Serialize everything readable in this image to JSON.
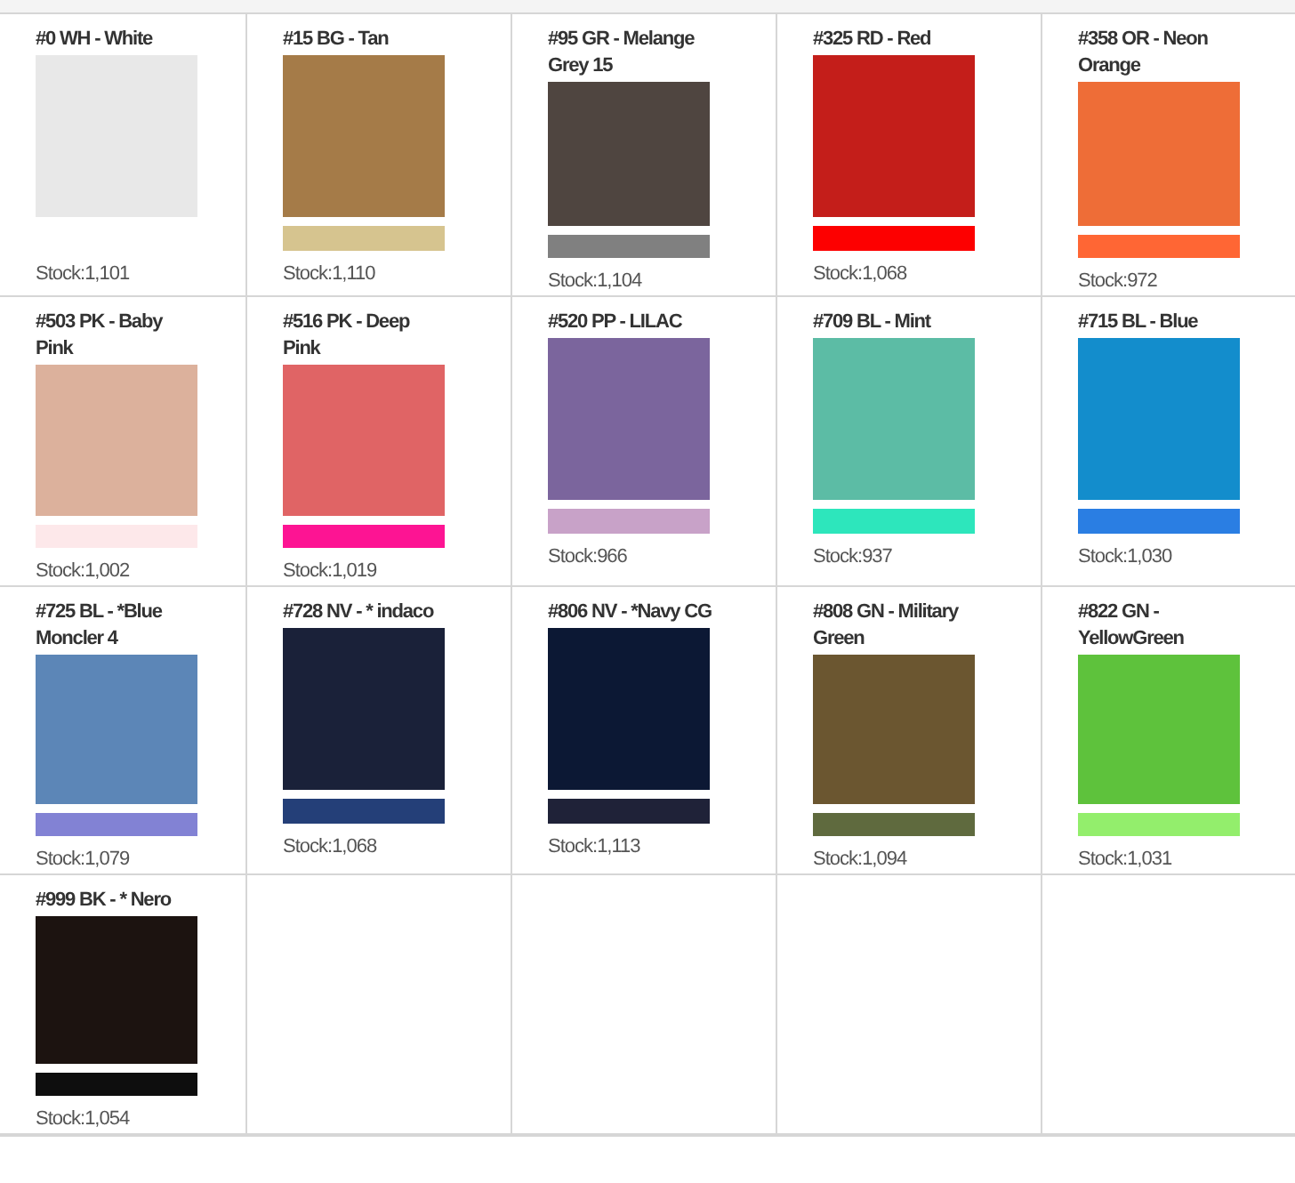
{
  "swatches": [
    {
      "label": "#0 WH - White",
      "color": "#e8e8e8",
      "stock": "Stock:1,101"
    },
    {
      "label": "#15 BG - Tan",
      "color": "#a57b48",
      "strip": {
        "color": "#d6c48f"
      },
      "stock": "Stock:1,110"
    },
    {
      "label": "#95 GR - Melange Grey 15",
      "color": "#4f4540",
      "strip": {
        "color": "#808080"
      },
      "stock": "Stock:1,104"
    },
    {
      "label": "#325 RD - Red",
      "color": "#c41e1a",
      "strip": {
        "color": "#fd0000"
      },
      "stock": "Stock:1,068"
    },
    {
      "label": "#358 OR - Neon Orange",
      "color": "#ee6d37",
      "strip": {
        "color": "#ff6634"
      },
      "stock": "Stock:972"
    },
    {
      "label": "#503 PK - Baby Pink",
      "color": "#dcb19c",
      "strip": {
        "color": "#fde8ea"
      },
      "stock": "Stock:1,002"
    },
    {
      "label": "#516 PK - Deep Pink",
      "color": "#e06465",
      "strip": {
        "color": "#fd1493"
      },
      "stock": "Stock:1,019"
    },
    {
      "label": "#520 PP - LILAC",
      "color": "#7b659d",
      "strip": {
        "color": "#c8a2c8"
      },
      "stock": "Stock:966"
    },
    {
      "label": "#709 BL - Mint",
      "color": "#5cbca5",
      "strip": {
        "color": "#2de6bc"
      },
      "stock": "Stock:937"
    },
    {
      "label": "#715 BL - Blue",
      "color": "#138dcc",
      "strip": {
        "color": "#2a7ee3"
      },
      "stock": "Stock:1,030"
    },
    {
      "label": "#725 BL - *Blue Moncler 4",
      "color": "#5c86b7",
      "strip": {
        "color": "#8282d4"
      },
      "stock": "Stock:1,079"
    },
    {
      "label": "#728 NV - * indaco",
      "color": "#1a2139",
      "strip": {
        "color": "#243f78"
      },
      "stock": "Stock:1,068"
    },
    {
      "label": "#806 NV - *Navy CG",
      "color": "#0c1834",
      "strip": {
        "color": "#1f2238"
      },
      "stock": "Stock:1,113"
    },
    {
      "label": "#808 GN - Military Green",
      "color": "#6b5630",
      "strip": {
        "color": "#5f6a3e"
      },
      "stock": "Stock:1,094"
    },
    {
      "label": "#822 GN - YellowGreen",
      "color": "#5ec23c",
      "strip": {
        "color": "#93ee6c"
      },
      "stock": "Stock:1,031"
    },
    {
      "label": "#999 BK - * Nero",
      "color": "#1c1310",
      "strip": {
        "color": "#0e0e0e"
      },
      "stock": "Stock:1,054"
    }
  ]
}
